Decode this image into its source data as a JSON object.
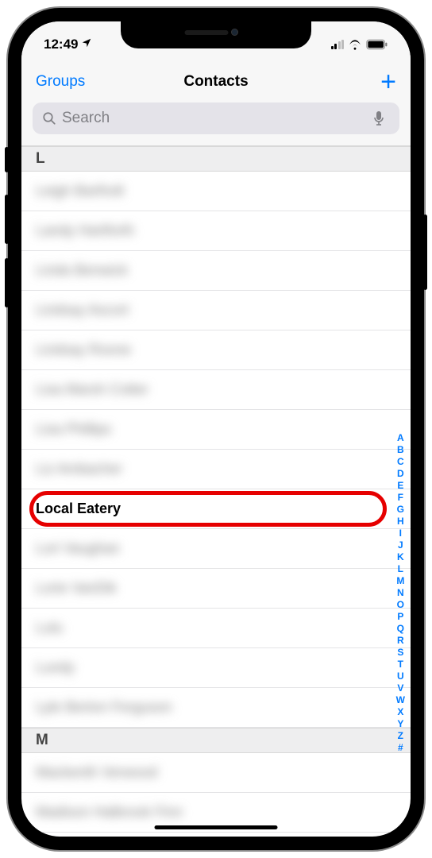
{
  "status": {
    "time": "12:49"
  },
  "nav": {
    "left": "Groups",
    "title": "Contacts",
    "add": "+"
  },
  "search": {
    "placeholder": "Search"
  },
  "sections": {
    "L": {
      "header": "L",
      "rows": [
        {
          "name": "Leigh Bartholt",
          "blurred": true
        },
        {
          "name": "Landy Hartforth",
          "blurred": true
        },
        {
          "name": "Linda Benwick",
          "blurred": true
        },
        {
          "name": "Lindsay Ascort",
          "blurred": true
        },
        {
          "name": "Lindsay Roone",
          "blurred": true
        },
        {
          "name": "Lisa Marsh Cotter",
          "blurred": true
        },
        {
          "name": "Lisa Phillips",
          "blurred": true
        },
        {
          "name": "Liz Ambacher",
          "blurred": true
        },
        {
          "name": "Local Eatery",
          "blurred": false,
          "highlighted": true
        },
        {
          "name": "Lori Vaughan",
          "blurred": true
        },
        {
          "name": "Lorie VanDik",
          "blurred": true
        },
        {
          "name": "Lulu",
          "blurred": true
        },
        {
          "name": "Lundy",
          "blurred": true
        },
        {
          "name": "Lyle Berton Ferguson",
          "blurred": true
        }
      ]
    },
    "M": {
      "header": "M",
      "rows": [
        {
          "name": "Mackenth Verwood",
          "blurred": true
        },
        {
          "name": "Madison Halbrook Finn",
          "blurred": true
        }
      ]
    }
  },
  "index": [
    "A",
    "B",
    "C",
    "D",
    "E",
    "F",
    "G",
    "H",
    "I",
    "J",
    "K",
    "L",
    "M",
    "N",
    "O",
    "P",
    "Q",
    "R",
    "S",
    "T",
    "U",
    "V",
    "W",
    "X",
    "Y",
    "Z",
    "#"
  ]
}
